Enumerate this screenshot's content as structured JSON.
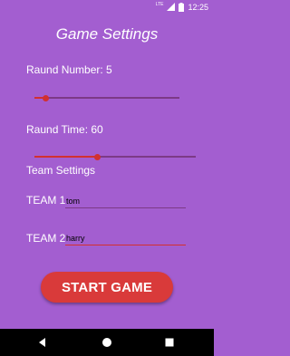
{
  "status_bar": {
    "network": "LTE",
    "time": "12:25",
    "icons": [
      "signal-icon",
      "battery-icon"
    ]
  },
  "screen": {
    "title": "Game Settings"
  },
  "round_number": {
    "label": "Raund Number: 5",
    "value": 5,
    "slider_fraction": 0.08
  },
  "round_time": {
    "label": "Raund Time: 60",
    "value": 60,
    "slider_fraction": 0.39
  },
  "team_settings": {
    "heading": "Team Settings",
    "team1": {
      "label": "TEAM 1",
      "value": "tom"
    },
    "team2": {
      "label": "TEAM 2",
      "value": "harry"
    }
  },
  "start_button": {
    "label": "START GAME"
  },
  "nav_bar": {
    "icons": [
      "back-icon",
      "home-icon",
      "recents-icon"
    ]
  },
  "colors": {
    "background": "#a35ed0",
    "accent": "#d23030",
    "button": "#d93a3a",
    "nav": "#000000"
  }
}
